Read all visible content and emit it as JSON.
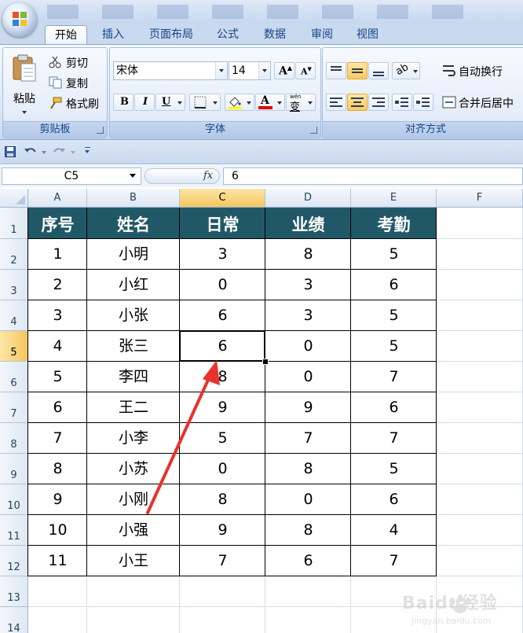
{
  "app": {
    "tabs": [
      "开始",
      "插入",
      "页面布局",
      "公式",
      "数据",
      "审阅",
      "视图"
    ],
    "active_tab": "开始"
  },
  "ribbon": {
    "clipboard": {
      "paste": "粘贴",
      "cut": "剪切",
      "copy": "复制",
      "format_painter": "格式刷",
      "label": "剪贴板"
    },
    "font": {
      "name": "宋体",
      "size": "14",
      "bold": "B",
      "italic": "I",
      "underline": "U",
      "phonetic": "wén",
      "phonetic_char": "变",
      "label": "字体"
    },
    "alignment": {
      "wrap": "自动换行",
      "merge": "合并后居中",
      "label": "对齐方式"
    }
  },
  "formula_bar": {
    "name_box": "C5",
    "fx": "fx",
    "value": "6"
  },
  "sheet": {
    "columns": [
      "A",
      "B",
      "C",
      "D",
      "E",
      "F"
    ],
    "rows": [
      "1",
      "2",
      "3",
      "4",
      "5",
      "6",
      "7",
      "8",
      "9",
      "10",
      "11",
      "12",
      "13",
      "14"
    ],
    "selected_cell": "C5",
    "header": [
      "序号",
      "姓名",
      "日常",
      "业绩",
      "考勤"
    ],
    "data": [
      [
        "1",
        "小明",
        "3",
        "8",
        "5"
      ],
      [
        "2",
        "小红",
        "0",
        "3",
        "6"
      ],
      [
        "3",
        "小张",
        "6",
        "3",
        "5"
      ],
      [
        "4",
        "张三",
        "6",
        "0",
        "5"
      ],
      [
        "5",
        "李四",
        "8",
        "0",
        "7"
      ],
      [
        "6",
        "王二",
        "9",
        "9",
        "6"
      ],
      [
        "7",
        "小李",
        "5",
        "7",
        "7"
      ],
      [
        "8",
        "小苏",
        "0",
        "8",
        "5"
      ],
      [
        "9",
        "小刚",
        "8",
        "0",
        "6"
      ],
      [
        "10",
        "小强",
        "9",
        "8",
        "4"
      ],
      [
        "11",
        "小王",
        "7",
        "6",
        "7"
      ]
    ]
  },
  "colors": {
    "header_fill": "#215868",
    "accent_orange": "#f5c65d",
    "annotation_arrow": "#e8322b"
  },
  "watermark": {
    "brand": "Baidu经验",
    "url": "jingyan.baidu.com"
  }
}
